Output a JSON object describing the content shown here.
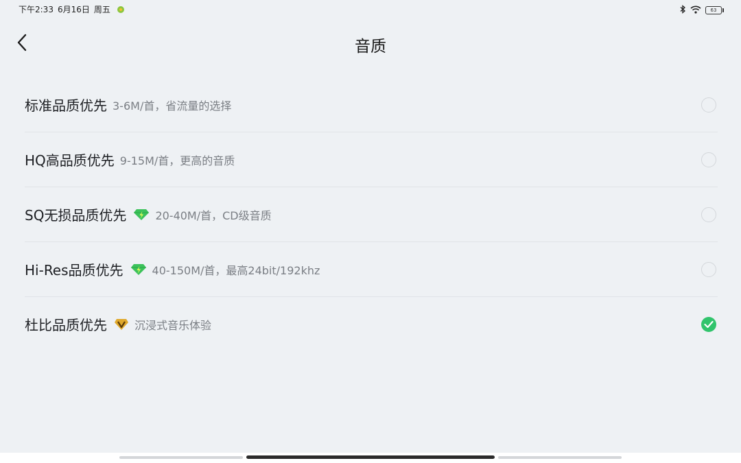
{
  "status_bar": {
    "time": "下午2:33",
    "date": "6月16日",
    "weekday": "周五",
    "battery": "63"
  },
  "header": {
    "title": "音质"
  },
  "options": [
    {
      "name": "标准品质优先",
      "desc": "3-6M/首，省流量的选择",
      "badge": null,
      "selected": false
    },
    {
      "name": "HQ高品质优先",
      "desc": "9-15M/首，更高的音质",
      "badge": null,
      "selected": false
    },
    {
      "name": "SQ无损品质优先",
      "desc": "20-40M/首，CD级音质",
      "badge": "green-diamond-icon",
      "selected": false
    },
    {
      "name": "Hi-Res品质优先",
      "desc": "40-150M/首，最高24bit/192khz",
      "badge": "green-diamond-icon",
      "selected": false
    },
    {
      "name": "杜比品质优先",
      "desc": "沉浸式音乐体验",
      "badge": "gold-diamond-icon",
      "selected": true
    }
  ],
  "colors": {
    "background": "#eef1f4",
    "selected_radio": "#31c46c",
    "green_diamond": "#3cc25b",
    "gold_diamond": "#e0a92c"
  }
}
